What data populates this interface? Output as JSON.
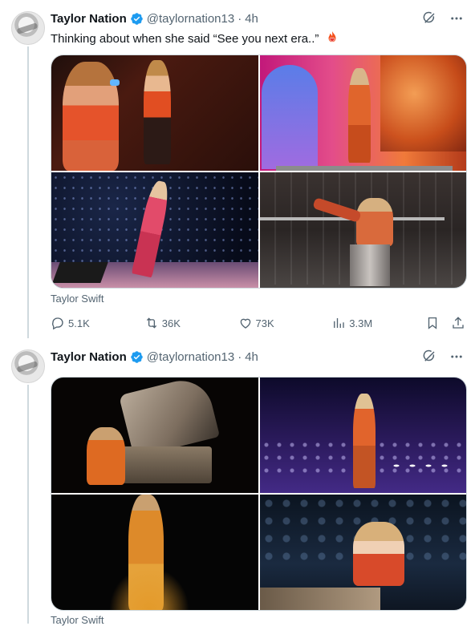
{
  "colors": {
    "text": "#0f1419",
    "secondary": "#536471",
    "verified": "#1d9bf0",
    "line": "#cfd9de"
  },
  "tweets": [
    {
      "name": "Taylor Nation",
      "handle": "@taylornation13",
      "separator": "·",
      "time": "4h",
      "text": "Thinking about when she said “See you next era..”",
      "caption": "Taylor Swift",
      "stats": {
        "replies": "5.1K",
        "reposts": "36K",
        "likes": "73K",
        "views": "3.3M"
      }
    },
    {
      "name": "Taylor Nation",
      "handle": "@taylornation13",
      "separator": "·",
      "time": "4h",
      "caption": "Taylor Swift"
    }
  ],
  "icons": [
    "verified-badge-icon",
    "grok-icon",
    "more-icon",
    "reply-icon",
    "repost-icon",
    "like-icon",
    "views-icon",
    "bookmark-icon",
    "share-icon",
    "fire-heart-emoji"
  ]
}
